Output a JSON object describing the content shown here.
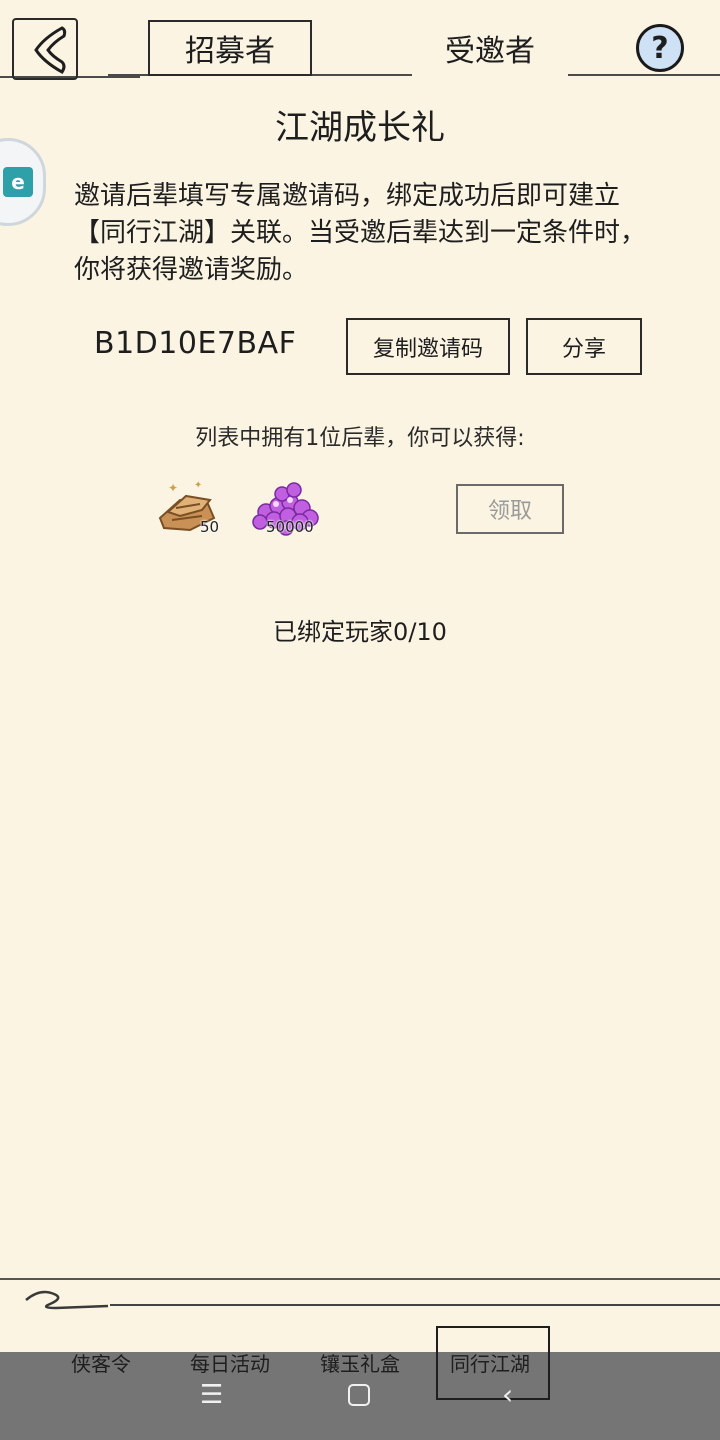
{
  "header": {
    "tabs": [
      "招募者",
      "受邀者"
    ],
    "help_label": "?"
  },
  "side_badge_text": "e",
  "main": {
    "title": "江湖成长礼",
    "description": "邀请后辈填写专属邀请码，绑定成功后即可建立【同行江湖】关联。当受邀后辈达到一定条件时，你将获得邀请奖励。",
    "invite_code": "B1D10E7BAF",
    "copy_label": "复制邀请码",
    "share_label": "分享",
    "list_note": "列表中拥有1位后辈，你可以获得:",
    "rewards": [
      {
        "icon": "gold-ingots-icon",
        "count": "50"
      },
      {
        "icon": "purple-gems-icon",
        "count": "50000"
      }
    ],
    "claim_label": "领取",
    "bound_players": "已绑定玩家0/10"
  },
  "bottom_tabs": [
    "侠客令",
    "每日活动",
    "镶玉礼盒",
    "同行江湖"
  ],
  "active_tab": "同行江湖",
  "colors": {
    "background": "#fbf4e3",
    "help_fill": "#cfe2f5",
    "system_bar": "#757575"
  }
}
